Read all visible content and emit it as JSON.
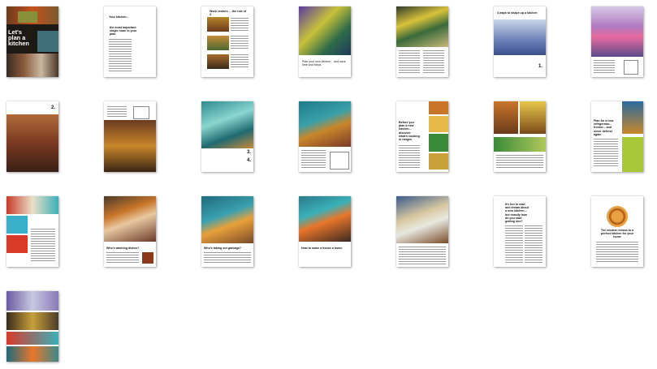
{
  "pages": [
    {
      "n": 1,
      "title": "Let's plan a kitchen"
    },
    {
      "n": 2,
      "title": "Your kitchen...",
      "subtitle": "the most important single room in your plan"
    },
    {
      "n": 3,
      "title": "Work centers ... the rule of 3"
    },
    {
      "n": 4,
      "caption": "Plan your own kitchen... and save time and steps"
    },
    {
      "n": 5
    },
    {
      "n": 6,
      "title": "4 ways to shape up a kitchen",
      "number": "1."
    },
    {
      "n": 7
    },
    {
      "n": 8,
      "number": "2."
    },
    {
      "n": 9
    },
    {
      "n": 10,
      "number": "3.",
      "number2": "4."
    },
    {
      "n": 11
    },
    {
      "n": 12,
      "title": "Before you plan a new kitchen... discover what's cooking in ranges"
    },
    {
      "n": 13
    },
    {
      "n": 14,
      "title": "Plan for a new refrigerator... freezer... and never defrost again"
    },
    {
      "n": 15
    },
    {
      "n": 16,
      "title": "Who's washing dishes?"
    },
    {
      "n": 17,
      "title": "Who's taking out garbage?"
    },
    {
      "n": 18,
      "title": "How to make a house a home"
    },
    {
      "n": 19
    },
    {
      "n": 20,
      "title": "It's fun to read and dream about a new kitchen... but exactly how do you start getting one?"
    },
    {
      "n": 21,
      "title": "The modern means to a perfect kitchen for your home"
    },
    {
      "n": 22
    }
  ]
}
